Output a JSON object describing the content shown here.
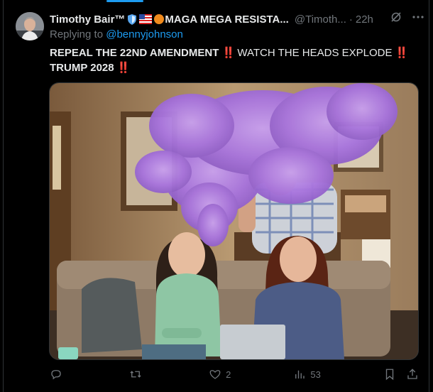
{
  "author": {
    "name": "Timothy Bair™",
    "badge_label": "MAGA MEGA RESISTA...",
    "handle": "@Timoth...",
    "time": "22h"
  },
  "reply": {
    "prefix": "Replying to",
    "mention": "@bennyjohnson"
  },
  "tweet": {
    "line1_part1": "REPEAL THE 22ND AMENDMENT",
    "line1_part2": " WATCH THE HEADS EXPLODE",
    "line2": "TRUMP 2028",
    "bangs": "‼️"
  },
  "actions": {
    "reply_count": "",
    "retweet_count": "",
    "like_count": "2",
    "views_count": "53"
  },
  "icons": {
    "reply": "reply-icon",
    "retweet": "retweet-icon",
    "like": "like-icon",
    "views": "views-icon",
    "bookmark": "bookmark-icon",
    "share": "share-icon",
    "grok": "grok-icon",
    "more": "more-icon"
  },
  "colors": {
    "accent": "#1d9bf0",
    "muted": "#71767b",
    "red": "#f4212e",
    "smoke": "#a86fe0"
  }
}
